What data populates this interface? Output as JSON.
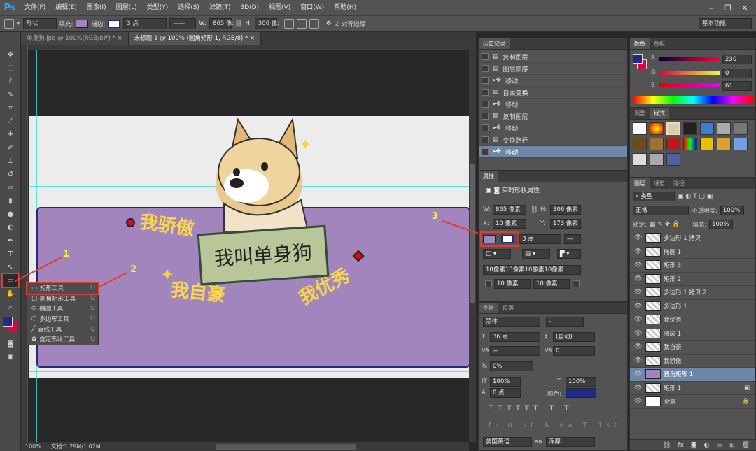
{
  "app": {
    "logo": "Ps"
  },
  "menu": [
    "文件(F)",
    "编辑(E)",
    "图像(I)",
    "图层(L)",
    "类型(Y)",
    "选择(S)",
    "滤镜(T)",
    "3D(D)",
    "视图(V)",
    "窗口(W)",
    "帮助(H)"
  ],
  "options": {
    "mode": "形状",
    "fill_label": "填充:",
    "fill_color": "#a285bd",
    "stroke_label": "描边:",
    "stroke_width": "3 点",
    "w_label": "W:",
    "w_value": "865 像:",
    "h_label": "H:",
    "h_value": "306 像:",
    "align_edges": "对齐边缘",
    "workspace": "基本功能"
  },
  "tabs": [
    {
      "label": "单身狗.jpg @ 100%(RGB/8#) *"
    },
    {
      "label": "未标题-1 @ 100% (圆角矩形 1, RGB/8) *"
    }
  ],
  "canvas": {
    "text_a": "我骄傲",
    "text_b": "我自豪",
    "text_c": "我优秀",
    "sign": "我叫单身狗"
  },
  "flyout": {
    "items": [
      {
        "label": "矩形工具",
        "key": "U"
      },
      {
        "label": "圆角矩形工具",
        "key": "U"
      },
      {
        "label": "椭圆工具",
        "key": "U"
      },
      {
        "label": "多边形工具",
        "key": "U"
      },
      {
        "label": "直线工具",
        "key": "U"
      },
      {
        "label": "自定形状工具",
        "key": "U"
      }
    ]
  },
  "annotations": {
    "n1": "1",
    "n2": "2",
    "n3": "3"
  },
  "status": {
    "zoom": "100%",
    "doc": "文档:1.29M/1.02M"
  },
  "history": {
    "tab": "历史记录",
    "items": [
      "复制图层",
      "图层顺序",
      "移动",
      "自由变换",
      "移动",
      "复制图层",
      "移动",
      "变换路径",
      "移动"
    ]
  },
  "properties": {
    "tab": "属性",
    "title": "实时形状属性",
    "w": "865 像素",
    "h": "306 像素",
    "x": "10 像素",
    "y": "173 像素",
    "stroke": "3 点",
    "radii": "10像素10像素10像素10像素",
    "r1": "10 像素",
    "r2": "10 像素",
    "labels": {
      "w": "W:",
      "h": "H:",
      "x": "X:",
      "y": "Y:"
    }
  },
  "character": {
    "tabs": [
      "字符",
      "段落"
    ],
    "font": "黑体",
    "font_style": "-",
    "size": "36 点",
    "leading": "(自动)",
    "tracking": "0",
    "scale_pct": "0%",
    "v_scale": "100%",
    "h_scale": "100%",
    "baseline": "0 点",
    "color_label": "颜色:",
    "color": "#1f2a8a",
    "language": "美国英语",
    "aa_label": "aa",
    "aa": "浑厚"
  },
  "color_panel": {
    "tabs": [
      "颜色",
      "色板"
    ],
    "r": "230",
    "g": "0",
    "b": "61",
    "labels": {
      "r": "R",
      "g": "G",
      "b": "B"
    },
    "fg": "#1f2a8a",
    "bg": "#e6003d"
  },
  "styles": {
    "tabs": [
      "调整",
      "样式"
    ]
  },
  "layers": {
    "tabs": [
      "图层",
      "通道",
      "路径"
    ],
    "filter": "类型",
    "blend": "正常",
    "opacity_label": "不透明度:",
    "opacity": "100%",
    "lock_label": "锁定:",
    "fill_label": "填充:",
    "fill": "100%",
    "items": [
      {
        "name": "多边形 1 拷贝"
      },
      {
        "name": "椭圆 1"
      },
      {
        "name": "矩形 3"
      },
      {
        "name": "矩形 2"
      },
      {
        "name": "多边形 1 拷贝 2"
      },
      {
        "name": "多边形 1"
      },
      {
        "name": "我优秀"
      },
      {
        "name": "图层 1"
      },
      {
        "name": "我自豪"
      },
      {
        "name": "我骄傲"
      },
      {
        "name": "圆角矩形 1"
      },
      {
        "name": "矩形 1"
      },
      {
        "name": "背景"
      }
    ]
  }
}
